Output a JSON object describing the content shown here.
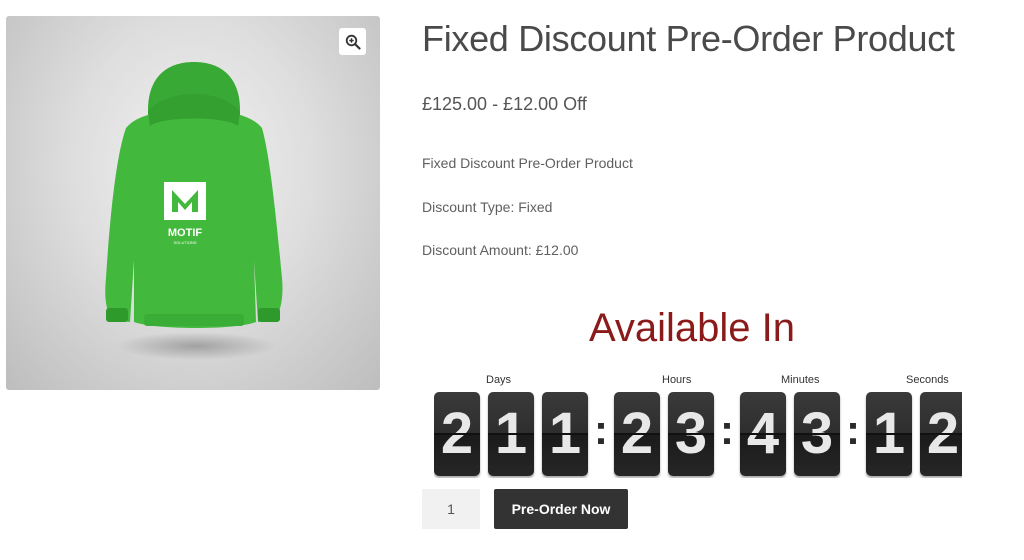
{
  "gallery": {
    "zoom_icon": "magnify-plus-icon",
    "logo_letter": "M",
    "logo_text": "MOTIF",
    "logo_subtext": "SOLUTIONS",
    "garment_color": "#3fb53a"
  },
  "product": {
    "title": "Fixed Discount Pre-Order Product",
    "price": "£125.00 - £12.00 Off",
    "description": [
      "Fixed Discount Pre-Order Product",
      "Discount Type: Fixed",
      "Discount Amount: £12.00"
    ]
  },
  "countdown": {
    "heading": "Available In",
    "heading_color": "#8b1a1a",
    "labels": {
      "days": "Days",
      "hours": "Hours",
      "minutes": "Minutes",
      "seconds": "Seconds"
    },
    "days": [
      "2",
      "1",
      "1"
    ],
    "hours": [
      "2",
      "3"
    ],
    "minutes": [
      "4",
      "3"
    ],
    "seconds": [
      "1",
      "2"
    ],
    "separator": ":"
  },
  "cart": {
    "quantity": "1",
    "button_label": "Pre-Order Now"
  }
}
